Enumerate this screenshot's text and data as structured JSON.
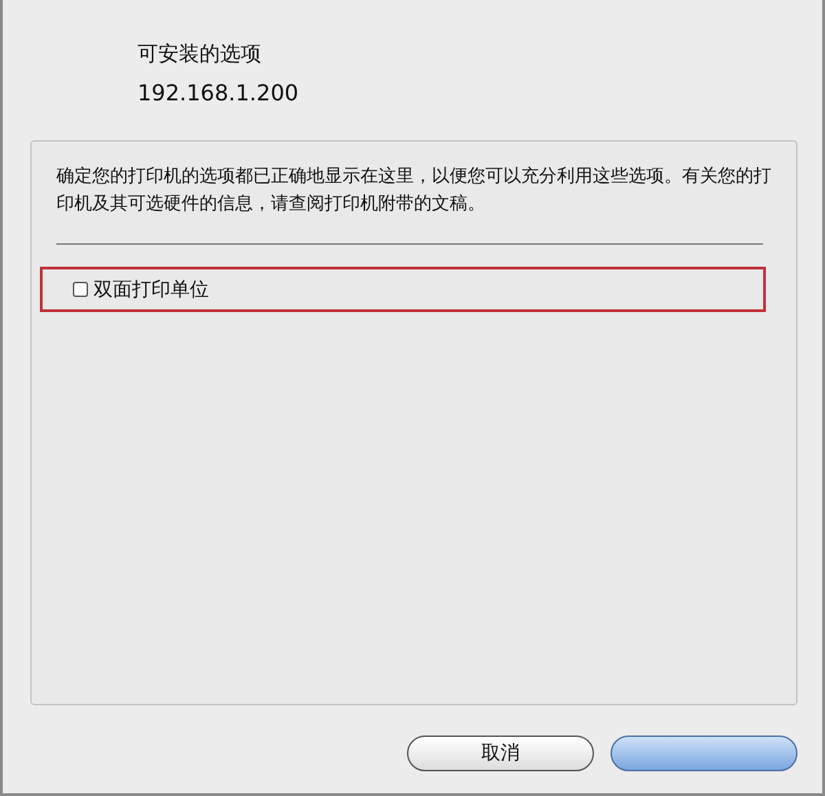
{
  "sheet": {
    "title": "可安装的选项",
    "printer_address": "192.168.1.200"
  },
  "description": "确定您的打印机的选项都已正确地显示在这里，以便您可以充分利用这些选项。有关您的打印机及其可选硬件的信息，请查阅打印机附带的文稿。",
  "options": [
    {
      "label": "双面打印单位",
      "checked": false,
      "highlighted": true
    }
  ],
  "buttons": [
    {
      "label": "取消",
      "kind": "cancel"
    },
    {
      "kind": "default"
    }
  ]
}
